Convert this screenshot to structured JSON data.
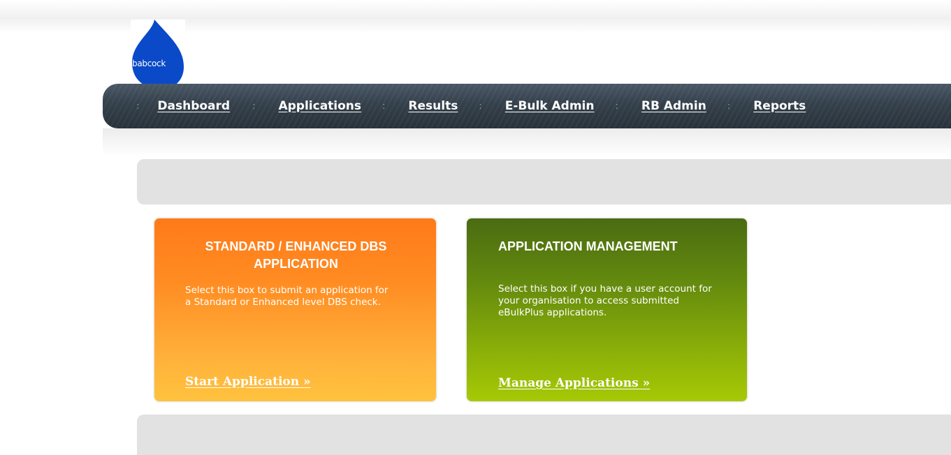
{
  "brand": {
    "logo_text": "babcock",
    "logo_color": "#0a4ac8"
  },
  "nav": {
    "separator": ":",
    "items": [
      {
        "label": "Dashboard"
      },
      {
        "label": "Applications"
      },
      {
        "label": "Results"
      },
      {
        "label": "E-Bulk Admin"
      },
      {
        "label": "RB Admin"
      },
      {
        "label": "Reports"
      }
    ]
  },
  "cards": [
    {
      "title": "STANDARD / ENHANCED DBS APPLICATION",
      "description": "Select this box to submit an application for a Standard or Enhanced level DBS check.",
      "link": "Start Application »",
      "color_top": "#ff7a1a",
      "color_bottom": "#ffc23e"
    },
    {
      "title": "APPLICATION MANAGEMENT",
      "description": "Select this box if you have a user account for your organisation to access submitted eBulkPlus applications.",
      "link": "Manage Applications »",
      "color_top": "#4b6b12",
      "color_bottom": "#a6c905"
    }
  ],
  "colors": {
    "navbar": "#34404b",
    "panel_grey": "#e2e2e2"
  }
}
